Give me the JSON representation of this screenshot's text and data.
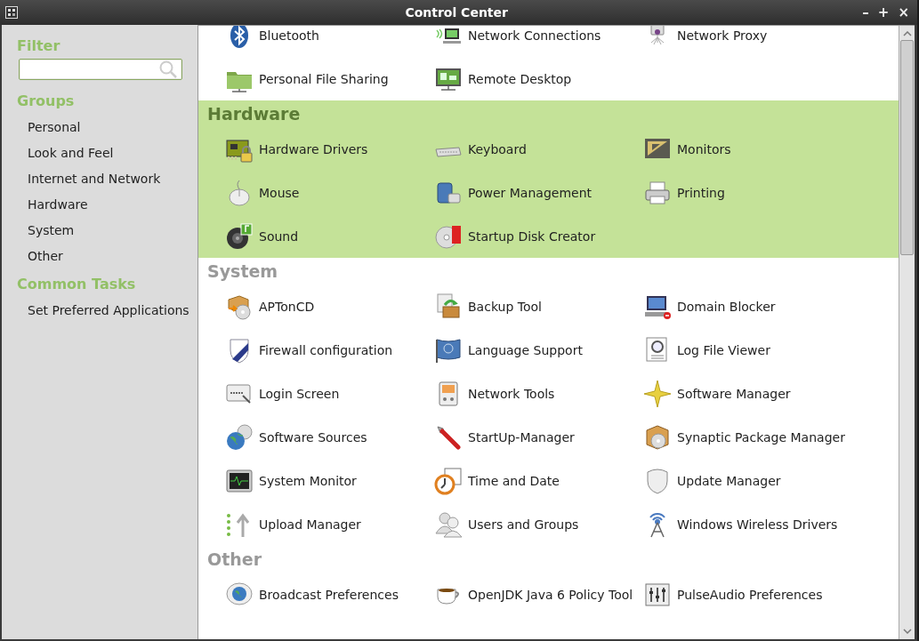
{
  "window": {
    "title": "Control Center",
    "controls": [
      "–",
      "+",
      "×"
    ]
  },
  "sidebar": {
    "filter": {
      "heading": "Filter"
    },
    "groups": {
      "heading": "Groups",
      "items": [
        {
          "label": "Personal"
        },
        {
          "label": "Look and Feel"
        },
        {
          "label": "Internet and Network"
        },
        {
          "label": "Hardware"
        },
        {
          "label": "System"
        },
        {
          "label": "Other"
        }
      ]
    },
    "common_tasks": {
      "heading": "Common Tasks",
      "items": [
        {
          "label": "Set Preferred Applications"
        }
      ]
    }
  },
  "sections": [
    {
      "highlighted": false,
      "items": [
        {
          "label": "Bluetooth"
        },
        {
          "label": "Network Connections"
        },
        {
          "label": "Network Proxy"
        },
        {
          "label": "Personal File Sharing"
        },
        {
          "label": "Remote Desktop"
        }
      ]
    },
    {
      "heading": "Hardware",
      "highlighted": true,
      "items": [
        {
          "label": "Hardware Drivers"
        },
        {
          "label": "Keyboard"
        },
        {
          "label": "Monitors"
        },
        {
          "label": "Mouse"
        },
        {
          "label": "Power Management"
        },
        {
          "label": "Printing"
        },
        {
          "label": "Sound"
        },
        {
          "label": "Startup Disk Creator"
        }
      ]
    },
    {
      "heading": "System",
      "highlighted": false,
      "items": [
        {
          "label": "APTonCD"
        },
        {
          "label": "Backup Tool"
        },
        {
          "label": "Domain Blocker"
        },
        {
          "label": "Firewall configuration"
        },
        {
          "label": "Language Support"
        },
        {
          "label": "Log File Viewer"
        },
        {
          "label": "Login Screen"
        },
        {
          "label": "Network Tools"
        },
        {
          "label": "Software Manager"
        },
        {
          "label": "Software Sources"
        },
        {
          "label": "StartUp-Manager"
        },
        {
          "label": "Synaptic Package Manager"
        },
        {
          "label": "System Monitor"
        },
        {
          "label": "Time and Date"
        },
        {
          "label": "Update Manager"
        },
        {
          "label": "Upload Manager"
        },
        {
          "label": "Users and Groups"
        },
        {
          "label": "Windows Wireless Drivers"
        }
      ]
    },
    {
      "heading": "Other",
      "highlighted": false,
      "items": [
        {
          "label": "Broadcast Preferences"
        },
        {
          "label": "OpenJDK Java 6 Policy Tool"
        },
        {
          "label": "PulseAudio Preferences"
        }
      ]
    }
  ]
}
